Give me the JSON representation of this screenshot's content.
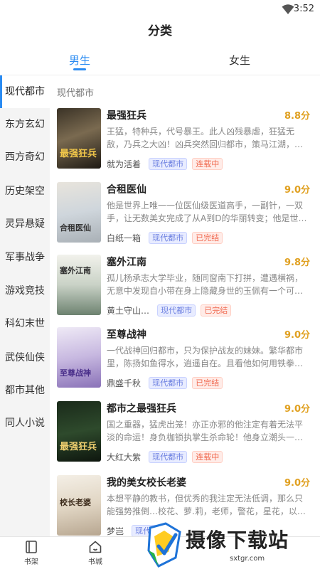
{
  "status_bar": {
    "time": "3:52",
    "wifi_icon": "wifi-icon"
  },
  "header": {
    "title": "分类"
  },
  "tabs": [
    {
      "label": "男生",
      "active": true
    },
    {
      "label": "女生",
      "active": false
    }
  ],
  "sidebar": {
    "items": [
      {
        "label": "现代都市",
        "active": true
      },
      {
        "label": "东方玄幻"
      },
      {
        "label": "西方奇幻"
      },
      {
        "label": "历史架空"
      },
      {
        "label": "灵异悬疑"
      },
      {
        "label": "军事战争"
      },
      {
        "label": "游戏竞技"
      },
      {
        "label": "科幻末世"
      },
      {
        "label": "武侠仙侠"
      },
      {
        "label": "都市其他"
      },
      {
        "label": "同人小说"
      }
    ]
  },
  "section": {
    "label": "现代都市"
  },
  "books": [
    {
      "title": "最强狂兵",
      "score": "8.8分",
      "desc": "王猛，特种兵，代号暴王。此人凶残暴虐，狂猛无敌，乃兵之大凶！凶兵突然回归都市，策马江湖，…",
      "author": "就为活着",
      "genre": "现代都市",
      "status": "连载中",
      "cover_text": "最强狂兵"
    },
    {
      "title": "合租医仙",
      "score": "9.0分",
      "desc": "他是世界上唯一一位医仙级医道高手，一副针，一双手，让无数美女完成了从A到D的华丽转变；他是世…",
      "author": "白纸一箱",
      "genre": "现代都市",
      "status": "已完结",
      "cover_text": "合租医仙"
    },
    {
      "title": "塞外江南",
      "score": "9.8分",
      "desc": "孤儿杨承志大学毕业，随同窗南下打拼，遭遇横祸，无意中发现自小带在身上隐藏身世的玉佩有一个可…",
      "author": "黄土守山…",
      "genre": "现代都市",
      "status": "已完结",
      "cover_text": "塞外江南"
    },
    {
      "title": "至尊战神",
      "score": "9.0分",
      "desc": "一代战神回归都市，只为保护战友的妹妹。繁华都市里，陈扬如鱼得水，逍遥自在。且看他如何用铁拳…",
      "author": "鼎盛千秋",
      "genre": "现代都市",
      "status": "已完结",
      "cover_text": "至尊战神"
    },
    {
      "title": "都市之最强狂兵",
      "score": "9.0分",
      "desc": "国之重器，猛虎出笼！亦正亦邪的他注定有着无法平淡的命运！身负枷锁执掌生杀命轮！他身立潮头一…",
      "author": "大红大紫",
      "genre": "现代都市",
      "status": "连载中",
      "cover_text": "最强狂兵"
    },
    {
      "title": "我的美女校长老婆",
      "score": "9.0分",
      "desc": "本想平静的教书，但优秀的我注定无法低调，那么只能强势推倒…校花、萝.莉，老师，警花，星花，以…",
      "author": "梦岂",
      "genre": "现代都市",
      "status": "",
      "cover_text": "校长老婆"
    }
  ],
  "bottom_nav": [
    {
      "label": "书架",
      "icon": "bookshelf-icon"
    },
    {
      "label": "书城",
      "icon": "home-icon"
    }
  ],
  "watermark": {
    "text": "摄像下载站",
    "url": "sxtgr.com"
  }
}
